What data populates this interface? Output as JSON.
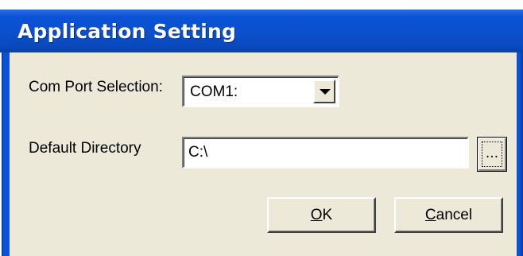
{
  "dialog": {
    "title": "Application Setting"
  },
  "com_port": {
    "label": "Com Port Selection:",
    "selected": "COM1:"
  },
  "directory": {
    "label": "Default Directory",
    "value": "C:\\",
    "browse_label": "..."
  },
  "buttons": {
    "ok": {
      "mnemonic": "O",
      "rest": "K"
    },
    "cancel": {
      "mnemonic": "C",
      "rest": "ancel"
    }
  },
  "colors": {
    "title_bar": "#0a52d6",
    "face": "#ece9d8",
    "title_text": "#ffffff"
  }
}
